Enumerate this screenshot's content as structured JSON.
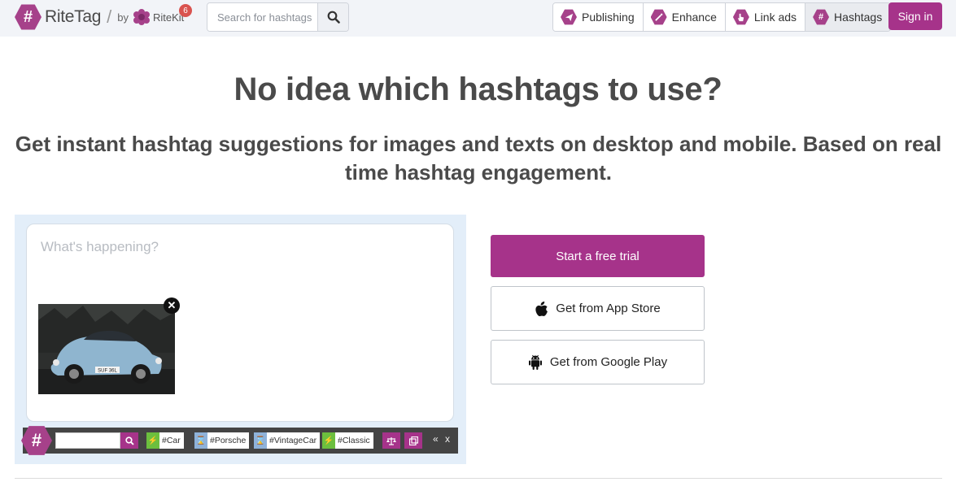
{
  "brand": {
    "name": "RiteTag",
    "slash": "/",
    "by": "by",
    "parent": "RiteKit",
    "notification_count": "6",
    "accent_color": "#a6338a"
  },
  "search": {
    "placeholder": "Search for hashtags",
    "icon": "search-icon"
  },
  "nav": {
    "items": [
      {
        "label": "Publishing",
        "icon": "paper-plane-icon",
        "active": false
      },
      {
        "label": "Enhance",
        "icon": "magic-wand-icon",
        "active": false
      },
      {
        "label": "Link ads",
        "icon": "pointer-hand-icon",
        "active": false
      },
      {
        "label": "Hashtags",
        "icon": "hash-icon",
        "active": true
      }
    ],
    "signin_label": "Sign in"
  },
  "hero": {
    "headline": "No idea which hashtags to use?",
    "subline": "Get instant hashtag suggestions for images and texts on desktop and mobile. Based on real time hashtag engagement."
  },
  "demo": {
    "composer_placeholder": "What's happening?",
    "close_symbol": "✕",
    "photo_plate": "SUF 36L",
    "tags": [
      {
        "label": "#Car",
        "kind": "green"
      },
      {
        "label": "#Porsche",
        "kind": "blue"
      },
      {
        "label": "#VintageCar",
        "kind": "blue"
      },
      {
        "label": "#Classic",
        "kind": "green"
      }
    ],
    "collapse_symbol": "«",
    "close_bar_symbol": "x"
  },
  "cta": {
    "trial_label": "Start a free trial",
    "appstore_label": "Get from App Store",
    "googleplay_label": "Get from Google Play"
  }
}
